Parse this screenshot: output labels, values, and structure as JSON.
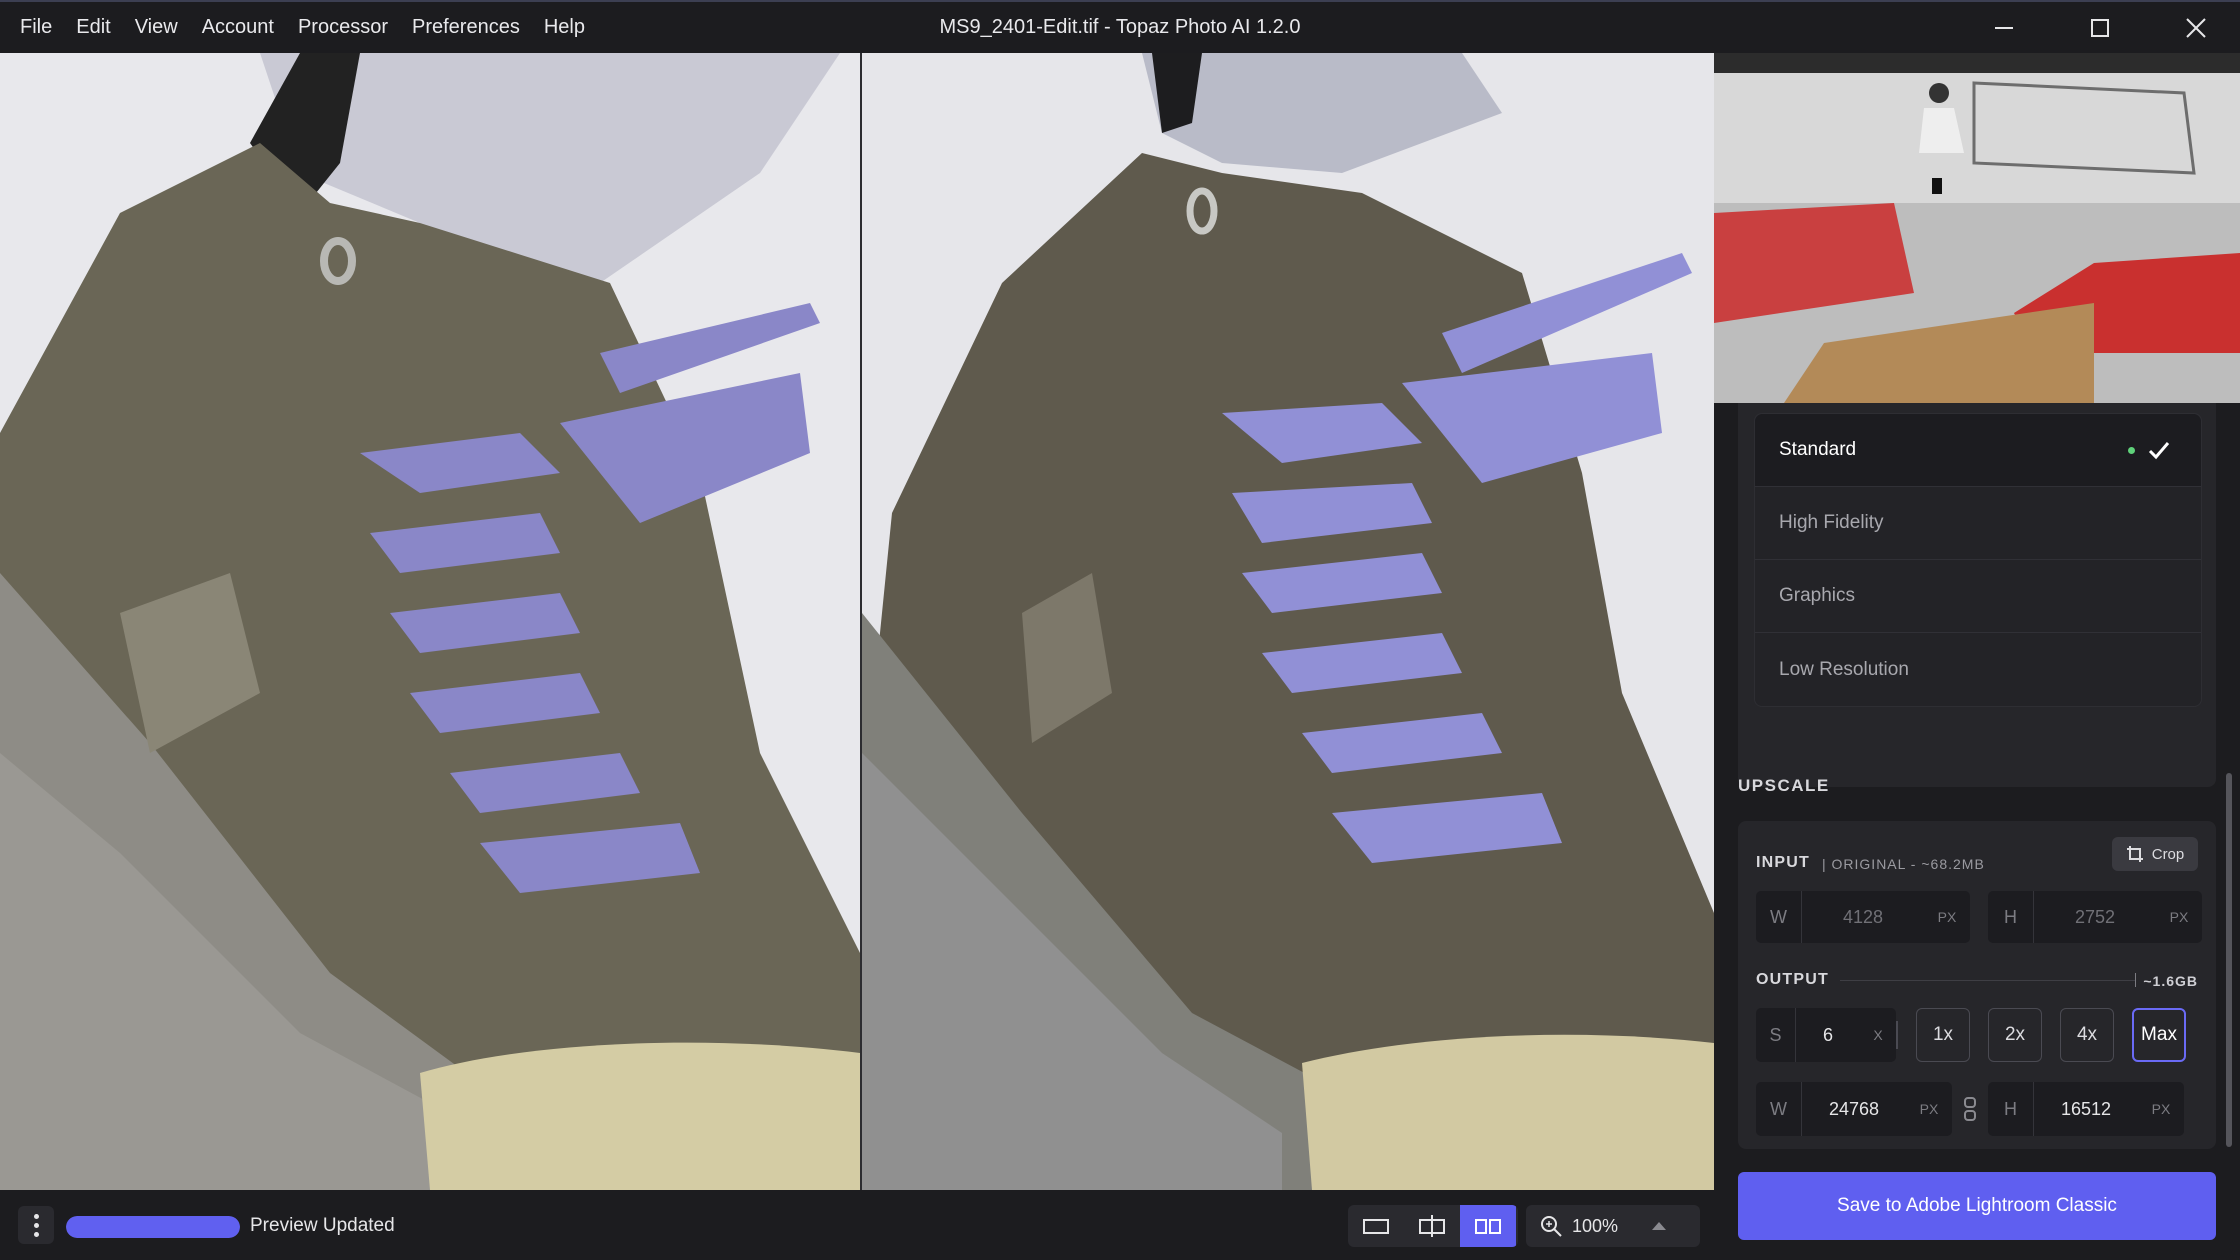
{
  "menu": [
    "File",
    "Edit",
    "View",
    "Account",
    "Processor",
    "Preferences",
    "Help"
  ],
  "window_title": "MS9_2401-Edit.tif - Topaz Photo AI 1.2.0",
  "models": [
    {
      "label": "Standard",
      "selected": true
    },
    {
      "label": "High Fidelity",
      "selected": false
    },
    {
      "label": "Graphics",
      "selected": false
    },
    {
      "label": "Low Resolution",
      "selected": false
    }
  ],
  "upscale": {
    "section_label": "UPSCALE",
    "input_label": "INPUT",
    "input_info": "| ORIGINAL - ~68.2MB",
    "crop_label": "Crop",
    "input_w_prefix": "W",
    "input_w": "4128",
    "input_h_prefix": "H",
    "input_h": "2752",
    "unit": "PX",
    "output_label": "OUTPUT",
    "output_size": "~1.6GB",
    "scale_prefix": "S",
    "scale_value": "6",
    "scale_suffix": "X",
    "scale_options": [
      "1x",
      "2x",
      "4x",
      "Max"
    ],
    "selected_scale": "Max",
    "output_w_prefix": "W",
    "output_w": "24768",
    "output_h_prefix": "H",
    "output_h": "16512"
  },
  "save_button": "Save to Adobe Lightroom Classic",
  "status": {
    "text": "Preview Updated",
    "progress": 1.0
  },
  "zoom": "100%",
  "colors": {
    "accent": "#5f5ff0",
    "status_dot": "#5fd27a",
    "panel_bg": "#1c1c1f"
  }
}
